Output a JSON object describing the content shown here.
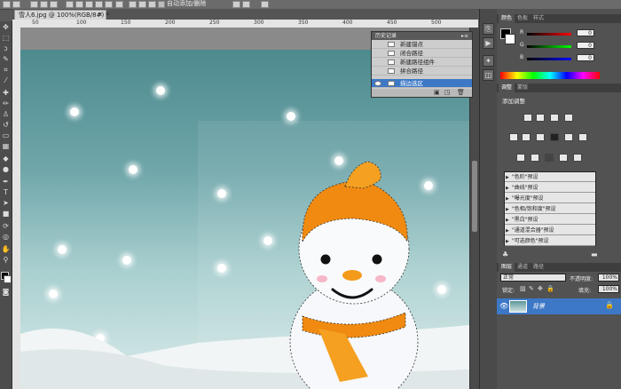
{
  "options_bar": {
    "label": "自动添加/删除"
  },
  "document": {
    "tab_title": "雪人6.jpg @ 100%(RGB/8#) *",
    "close_glyph": "×",
    "ruler_top_numbers": [
      "50",
      "100",
      "150",
      "200",
      "250",
      "300",
      "350",
      "400",
      "450",
      "500"
    ]
  },
  "history_panel": {
    "title": "历史记录",
    "items": [
      {
        "label": "新建锚点",
        "selected": false
      },
      {
        "label": "闭合路径",
        "selected": false
      },
      {
        "label": "新建路径组件",
        "selected": false
      },
      {
        "label": "拼合路径",
        "selected": false
      },
      {
        "label": "描边选区",
        "selected": true
      }
    ]
  },
  "color_panel": {
    "tabs": [
      "颜色",
      "色板",
      "样式"
    ],
    "active_tab": 0,
    "channels": [
      {
        "label": "R",
        "value": "0"
      },
      {
        "label": "G",
        "value": "0"
      },
      {
        "label": "B",
        "value": "0"
      }
    ]
  },
  "adjust_panel": {
    "tabs": [
      "调整",
      "蒙版"
    ],
    "active_tab": 0,
    "heading": "添加调整",
    "presets": [
      "\"色阶\"预设",
      "\"曲线\"预设",
      "\"曝光度\"预设",
      "\"色相/饱和度\"预设",
      "\"黑白\"预设",
      "\"通道混合器\"预设",
      "\"可选颜色\"预设"
    ]
  },
  "layers_panel": {
    "tabs": [
      "图层",
      "通道",
      "路径"
    ],
    "active_tab": 0,
    "blend_mode": "正常",
    "opacity_label": "不透明度:",
    "opacity_value": "100%",
    "lock_label": "锁定:",
    "fill_label": "填充:",
    "fill_value": "100%",
    "layer_name": "背景"
  },
  "colors": {
    "sky_top": "#4d8a8e",
    "hat_orange": "#f08a10",
    "selection_blue": "#3d78c7"
  }
}
